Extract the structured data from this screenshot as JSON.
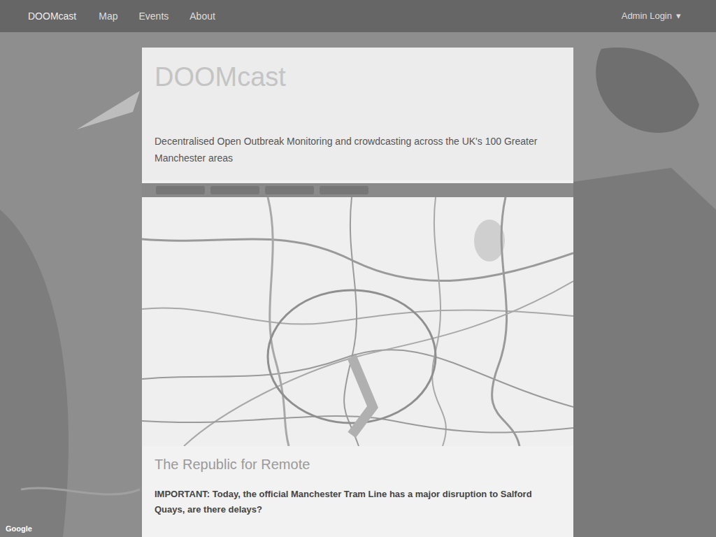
{
  "nav": {
    "brand": "DOOMcast",
    "links": [
      {
        "label": "Map",
        "selected": false
      },
      {
        "label": "Events",
        "selected": false
      },
      {
        "label": "About",
        "selected": false
      }
    ],
    "account": "Admin Login",
    "caret": "▾"
  },
  "header": {
    "title": "DOOMcast",
    "tagline": "Decentralised Open Outbreak Monitoring and crowdcasting across the UK's 100 Greater Manchester areas"
  },
  "map_toolbar": {
    "tabs": [
      "",
      "",
      "",
      ""
    ]
  },
  "section": {
    "heading": "The Republic for Remote",
    "text": "IMPORTANT: Today, the official Manchester Tram Line has a major disruption to Salford Quays, are there delays?"
  },
  "background_map": {
    "attribution": "Google"
  }
}
